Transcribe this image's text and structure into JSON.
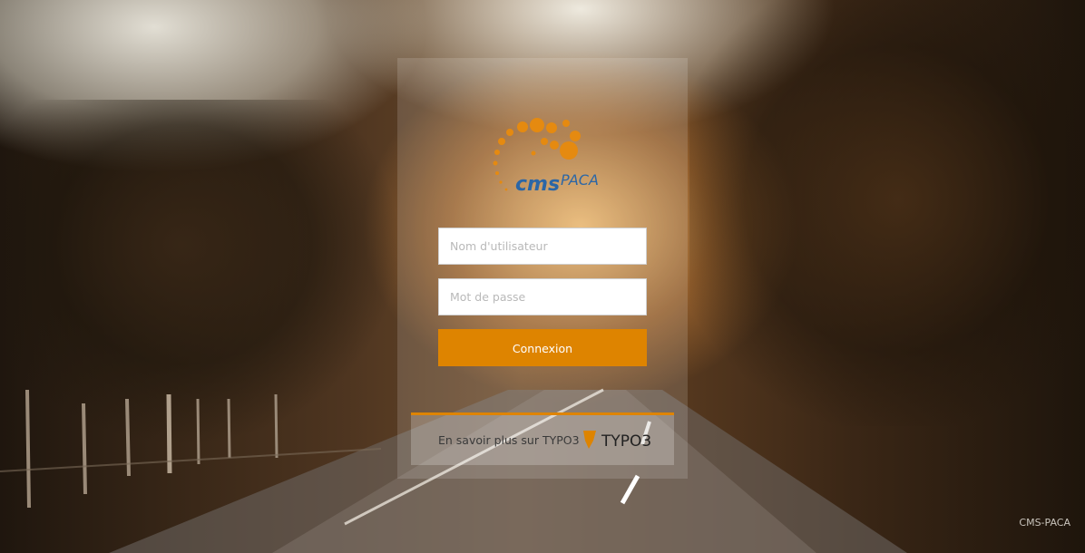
{
  "login": {
    "logo_alt": "cms PACA",
    "username_placeholder": "Nom d'utilisateur",
    "password_placeholder": "Mot de passe",
    "submit_label": "Connexion"
  },
  "footer": {
    "learn_more_label": "En savoir plus sur TYPO3",
    "typo3_logo_text": "TYPO3"
  },
  "copyright": "CMS-PACA",
  "colors": {
    "accent": "#de8400",
    "logo_orange": "#e58a10",
    "logo_blue": "#2b66a6"
  }
}
